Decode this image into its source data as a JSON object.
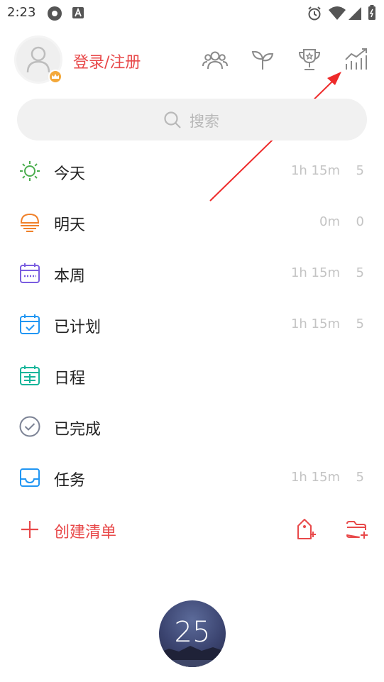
{
  "status_bar": {
    "time": "2:23"
  },
  "header": {
    "login_label": "登录/注册"
  },
  "search": {
    "placeholder": "搜索"
  },
  "lists": [
    {
      "label": "今天",
      "duration": "1h 15m",
      "count": "5",
      "icon": "sun-icon",
      "color": "#4cae4f"
    },
    {
      "label": "明天",
      "duration": "0m",
      "count": "0",
      "icon": "sunset-icon",
      "color": "#f0812a"
    },
    {
      "label": "本周",
      "duration": "1h 15m",
      "count": "5",
      "icon": "calendar-week-icon",
      "color": "#7a5de0"
    },
    {
      "label": "已计划",
      "duration": "1h 15m",
      "count": "5",
      "icon": "calendar-check-icon",
      "color": "#2196f3"
    },
    {
      "label": "日程",
      "duration": "",
      "count": "",
      "icon": "calendar-grid-icon",
      "color": "#16b59a"
    },
    {
      "label": "已完成",
      "duration": "",
      "count": "",
      "icon": "check-circle-icon",
      "color": "#7b8294"
    },
    {
      "label": "任务",
      "duration": "1h 15m",
      "count": "5",
      "icon": "inbox-icon",
      "color": "#2196f3"
    }
  ],
  "create": {
    "label": "创建清单"
  },
  "pomodoro": {
    "value": "25"
  },
  "colors": {
    "accent": "#e8494a",
    "muted": "#c4c4c4"
  }
}
